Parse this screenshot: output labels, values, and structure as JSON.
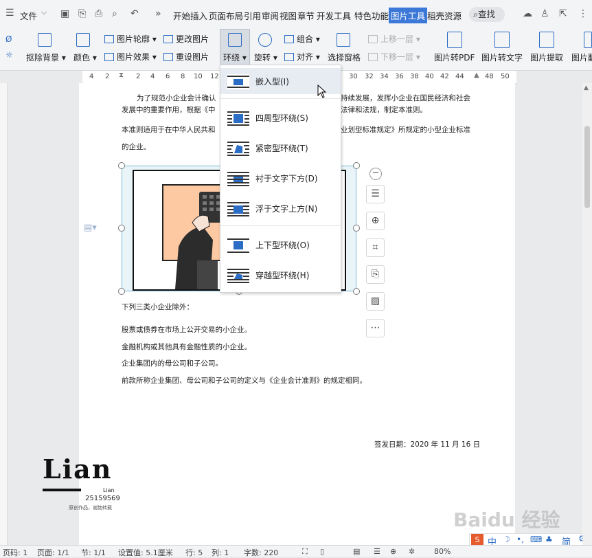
{
  "menubar": {
    "menu_icon": "hamburger-icon",
    "file_label": "文件",
    "tabs": [
      "开始",
      "插入",
      "页面布局",
      "引用",
      "审阅",
      "视图",
      "章节",
      "开发工具",
      "特色功能",
      "图片工具",
      "稻壳资源"
    ],
    "active_tab": "图片工具",
    "search_label": "查找"
  },
  "ribbon": {
    "remove_bg": "抠除背景",
    "color": "颜色",
    "outline": "图片轮廓",
    "effect": "图片效果",
    "change_pic": "更改图片",
    "reset_pic": "重设图片",
    "wrap": "环绕",
    "rotate": "旋转",
    "group": "组合",
    "align": "对齐",
    "select_pane": "选择窗格",
    "bring_forward": "上移一层",
    "send_backward": "下移一层",
    "to_pdf": "图片转PDF",
    "to_text": "图片转文字",
    "extract": "图片提取",
    "extra": "图片翻"
  },
  "ruler": [
    "4",
    "2",
    "2",
    "4",
    "6",
    "8",
    "10",
    "12",
    "30",
    "32",
    "34",
    "36",
    "38",
    "40",
    "42",
    "44",
    "48",
    "50"
  ],
  "document": {
    "p1_line1_a": "为了规范小企业会计确认",
    "p1_line1_b": "持续发展，发挥小企业在国民经济和社会",
    "p1_line2_a": "发展中的重要作用，根据《中",
    "p1_line2_b": "法律和法规，制定本准则。",
    "p2_line1_a": "本准则适用于在中华人民共和",
    "p2_line1_b": "业划型标准规定》所规定的小型企业标准",
    "p2_line2": "的企业。",
    "p3": "下列三类小企业除外：",
    "p4": "股票或债券在市场上公开交易的小企业。",
    "p5": "金融机构或其他具有金融性质的小企业。",
    "p6": "企业集团内的母公司和子公司。",
    "p7": "前款所称企业集团、母公司和子公司的定义与《企业会计准则》的规定相同。",
    "date": "签发日期：2020 年 11 月 16 日"
  },
  "wrap_menu": {
    "items": [
      {
        "label": "嵌入型(I)",
        "icon": "inline-wrap-icon"
      },
      {
        "label": "四周型环绕(S)",
        "icon": "square-wrap-icon"
      },
      {
        "label": "紧密型环绕(T)",
        "icon": "tight-wrap-icon"
      },
      {
        "label": "衬于文字下方(D)",
        "icon": "behind-text-icon"
      },
      {
        "label": "浮于文字上方(N)",
        "icon": "in-front-text-icon"
      },
      {
        "label": "上下型环绕(O)",
        "icon": "top-bottom-wrap-icon"
      },
      {
        "label": "穿越型环绕(H)",
        "icon": "through-wrap-icon"
      }
    ]
  },
  "watermark": {
    "brand": "Lian",
    "sub": "Lian",
    "id": "25159569",
    "note": "原创作品，谢绝转载",
    "baidu": "Baidu 经验"
  },
  "statusbar": {
    "page_no": "页码: 1",
    "pages": "页面: 1/1",
    "section": "节: 1/1",
    "setting": "设置值: 5.1厘米",
    "row": "行: 5",
    "col": "列: 1",
    "words": "字数: 220",
    "zoom": "80%"
  },
  "ime": {
    "zh": "中",
    "simplified": "简"
  },
  "colors": {
    "accent": "#3c78d8",
    "icon_blue": "#2b6cc4",
    "image_bg": "#fcc9a3"
  }
}
